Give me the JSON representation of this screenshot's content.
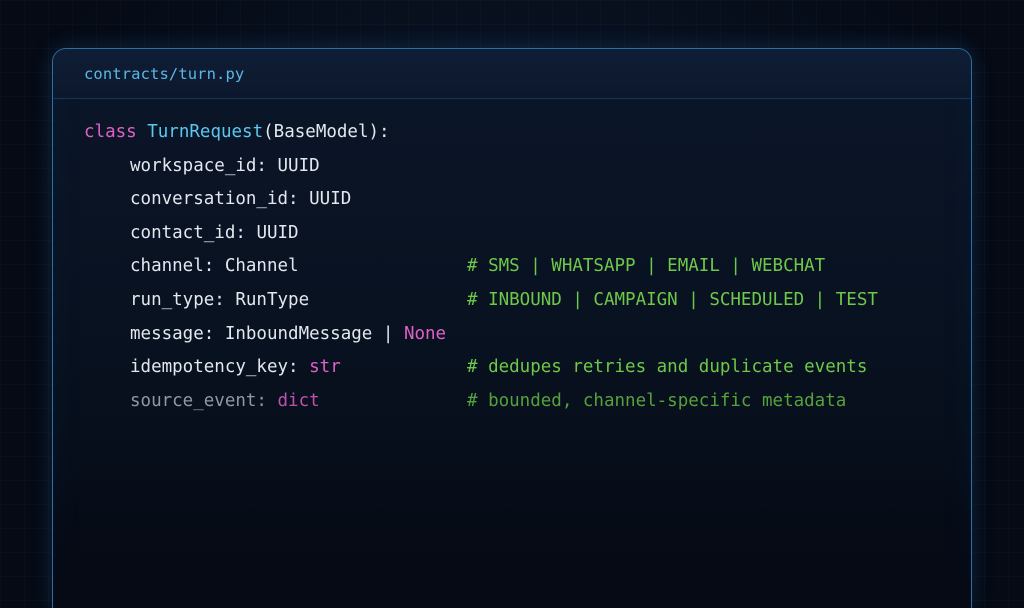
{
  "window": {
    "filename": "contracts/turn.py"
  },
  "code": {
    "class_keyword": "class",
    "class_name": "TurnRequest",
    "class_base": "(BaseModel):",
    "fields": [
      {
        "name": "workspace_id: ",
        "type": "UUID",
        "type_kind": "plain",
        "comment": ""
      },
      {
        "name": "conversation_id: ",
        "type": "UUID",
        "type_kind": "plain",
        "comment": ""
      },
      {
        "name": "contact_id: ",
        "type": "UUID",
        "type_kind": "plain",
        "comment": ""
      },
      {
        "name": "channel: ",
        "type": "Channel",
        "type_kind": "plain",
        "comment": "# SMS | WHATSAPP | EMAIL | WEBCHAT"
      },
      {
        "name": "run_type: ",
        "type": "RunType",
        "type_kind": "plain",
        "comment": "# INBOUND | CAMPAIGN | SCHEDULED | TEST"
      },
      {
        "name": "message: ",
        "type": "InboundMessage | ",
        "type_kind": "plain",
        "type_extra": "None",
        "comment": ""
      },
      {
        "name": "idempotency_key: ",
        "type": "str",
        "type_kind": "builtin",
        "comment": "# dedupes retries and duplicate events"
      },
      {
        "name": "source_event: ",
        "type": "dict",
        "type_kind": "builtin",
        "comment": "# bounded, channel-specific metadata"
      }
    ]
  },
  "colors": {
    "keyword": "#e060c8",
    "class_name": "#5cc8f0",
    "comment": "#6ec84a",
    "text": "#e3e8ef",
    "filename": "#5ab8e8",
    "border": "#2a6fa8"
  }
}
